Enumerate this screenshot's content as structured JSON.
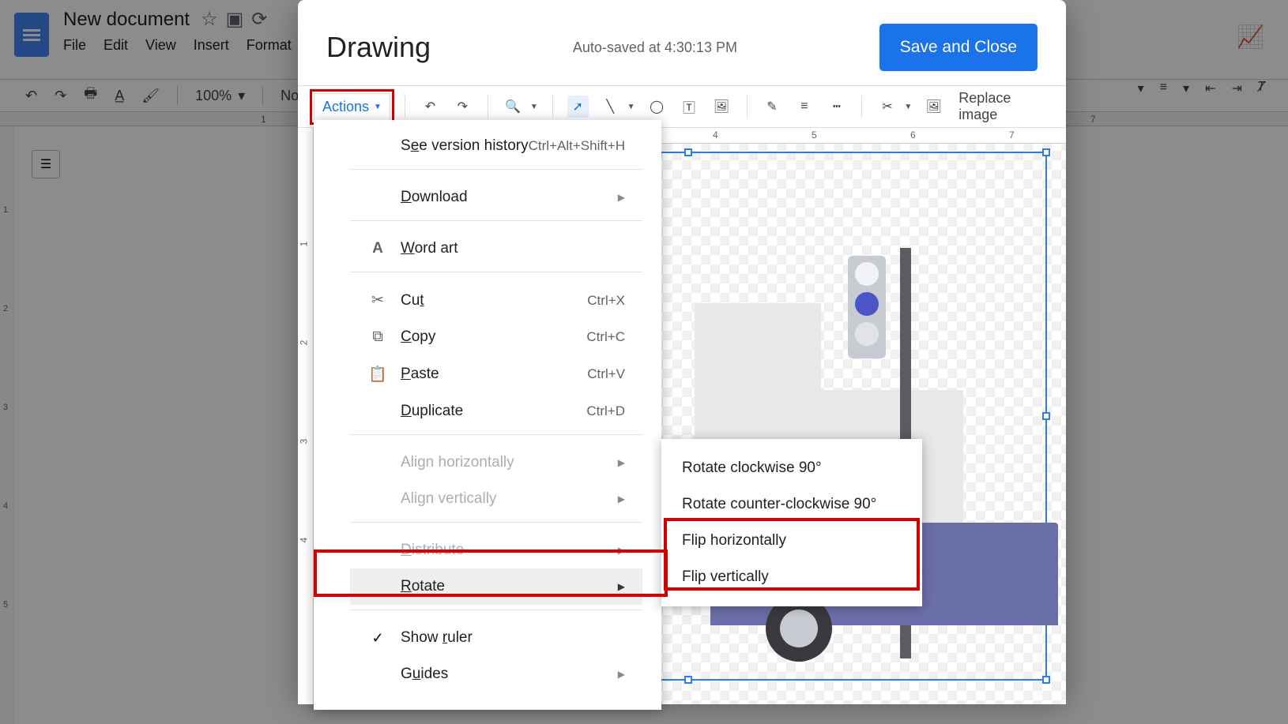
{
  "doc": {
    "title": "New document",
    "menus": [
      "File",
      "Edit",
      "View",
      "Insert",
      "Format"
    ],
    "zoom": "100%",
    "style": "Norm"
  },
  "modal": {
    "title": "Drawing",
    "autosave": "Auto-saved at 4:30:13 PM",
    "save_btn": "Save and Close",
    "actions_label": "Actions",
    "replace_image": "Replace image"
  },
  "h_ruler": {
    "t4": "4",
    "t5": "5",
    "t6": "6",
    "t7": "7",
    "t7b": "7"
  },
  "v_ruler_canvas": {
    "r1": "1",
    "r2": "2",
    "r3": "3",
    "r4": "4"
  },
  "doc_h_ruler": {
    "n1": "1"
  },
  "doc_v_ruler": {
    "n1": "1",
    "n2": "2",
    "n3": "3",
    "n4": "4",
    "n5": "5"
  },
  "menu": {
    "version": {
      "label_pre": "S",
      "label_und": "e",
      "label_post": "e version history",
      "shortcut": "Ctrl+Alt+Shift+H"
    },
    "download": {
      "label_und": "D",
      "label_post": "ownload"
    },
    "wordart": {
      "label_und": "W",
      "label_post": "ord art"
    },
    "cut": {
      "label_pre": "Cu",
      "label_und": "t",
      "shortcut": "Ctrl+X"
    },
    "copy": {
      "label_und": "C",
      "label_post": "opy",
      "shortcut": "Ctrl+C"
    },
    "paste": {
      "label_und": "P",
      "label_post": "aste",
      "shortcut": "Ctrl+V"
    },
    "duplicate": {
      "label_und": "D",
      "label_post": "uplicate",
      "shortcut": "Ctrl+D"
    },
    "alignh": {
      "label": "Align horizontally"
    },
    "alignv": {
      "label": "Align vertically"
    },
    "distribute": {
      "label_und": "D",
      "label_post": "istribute"
    },
    "rotate": {
      "label_und": "R",
      "label_post": "otate"
    },
    "showruler": {
      "label_pre": "Show ",
      "label_und": "r",
      "label_post": "uler"
    },
    "guides": {
      "label_pre": "G",
      "label_und": "u",
      "label_post": "ides"
    }
  },
  "submenu": {
    "rcw": "Rotate clockwise 90°",
    "rccw": "Rotate counter-clockwise 90°",
    "fliph": "Flip horizontally",
    "flipv": "Flip vertically"
  }
}
